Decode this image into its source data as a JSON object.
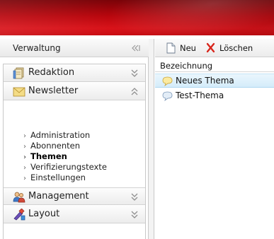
{
  "left_panel": {
    "title": "Verwaltung",
    "sections": [
      {
        "label": "Redaktion",
        "icon": "document-stack-icon",
        "expanded": false
      },
      {
        "label": "Newsletter",
        "icon": "envelope-icon",
        "expanded": true
      },
      {
        "label": "Management",
        "icon": "users-icon",
        "expanded": false
      },
      {
        "label": "Layout",
        "icon": "paint-tools-icon",
        "expanded": false
      }
    ],
    "newsletter_items": [
      {
        "label": "Administration",
        "active": false
      },
      {
        "label": "Abonnenten",
        "active": false
      },
      {
        "label": "Themen",
        "active": true
      },
      {
        "label": "Verifizierungstexte",
        "active": false
      },
      {
        "label": "Einstellungen",
        "active": false
      }
    ]
  },
  "toolbar": {
    "new_label": "Neu",
    "delete_label": "Löschen"
  },
  "list": {
    "column_header": "Bezeichnung",
    "rows": [
      {
        "label": "Neues Thema",
        "selected": true
      },
      {
        "label": "Test-Thema",
        "selected": false
      }
    ]
  },
  "colors": {
    "banner_red": "#c90c12",
    "selection": "#d4ecfa"
  }
}
